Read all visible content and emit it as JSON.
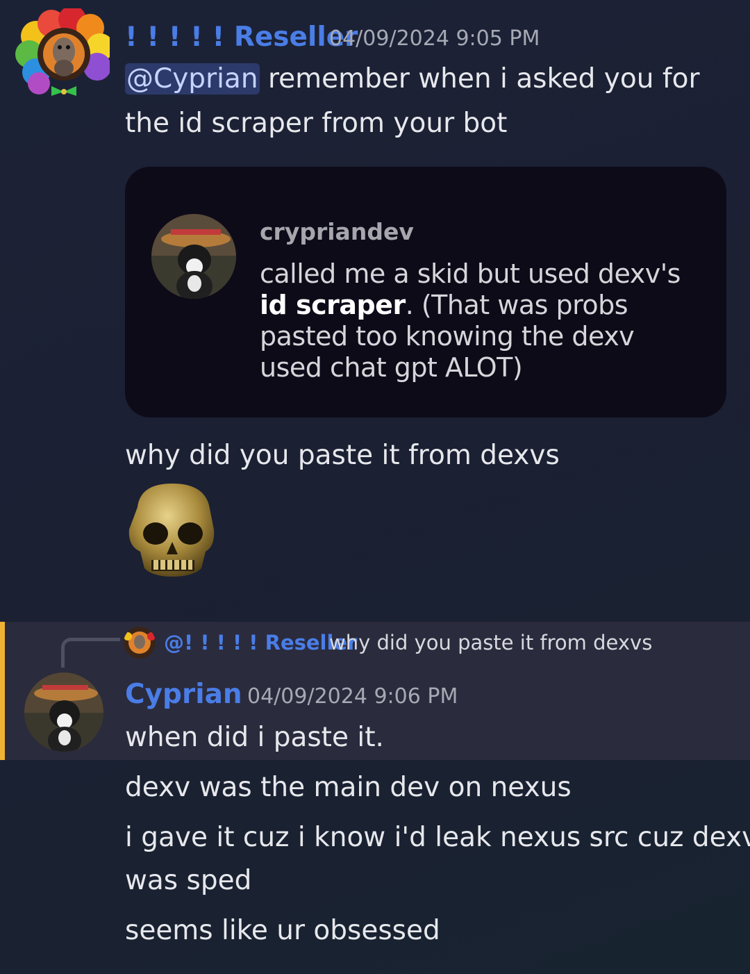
{
  "message1": {
    "username": "! ! ! ! ! Reseller",
    "timestamp": "04/09/2024 9:05 PM",
    "mention": "@Cyprian",
    "line1_rest": " remember when i asked you for",
    "line2": "the id scraper from your bot",
    "embed": {
      "author": "crypriandev",
      "text_part1": "called me a skid but used dexv's ",
      "text_bold": "id scraper",
      "text_part2": ". (That was probs pasted too knowing the dexv used chat gpt ALOT)"
    },
    "line3": "why did you paste it from dexvs",
    "emoji": "skull-emoji"
  },
  "message2": {
    "reply": {
      "mention": "@! ! ! ! ! Reseller",
      "text": "why did you paste it from dexvs"
    },
    "username": "Cyprian",
    "timestamp": "04/09/2024 9:06 PM",
    "lines": [
      "when did i paste it.",
      "dexv was the main dev on nexus",
      "i gave it cuz i know i'd leak nexus src cuz dexv",
      "was sped",
      "seems like ur obsessed"
    ]
  },
  "colors": {
    "username": "#4a7de6",
    "highlight_bar": "#f0b232",
    "highlight_bg": "#2a2b3d",
    "embed_bg": "#0e0b19"
  }
}
